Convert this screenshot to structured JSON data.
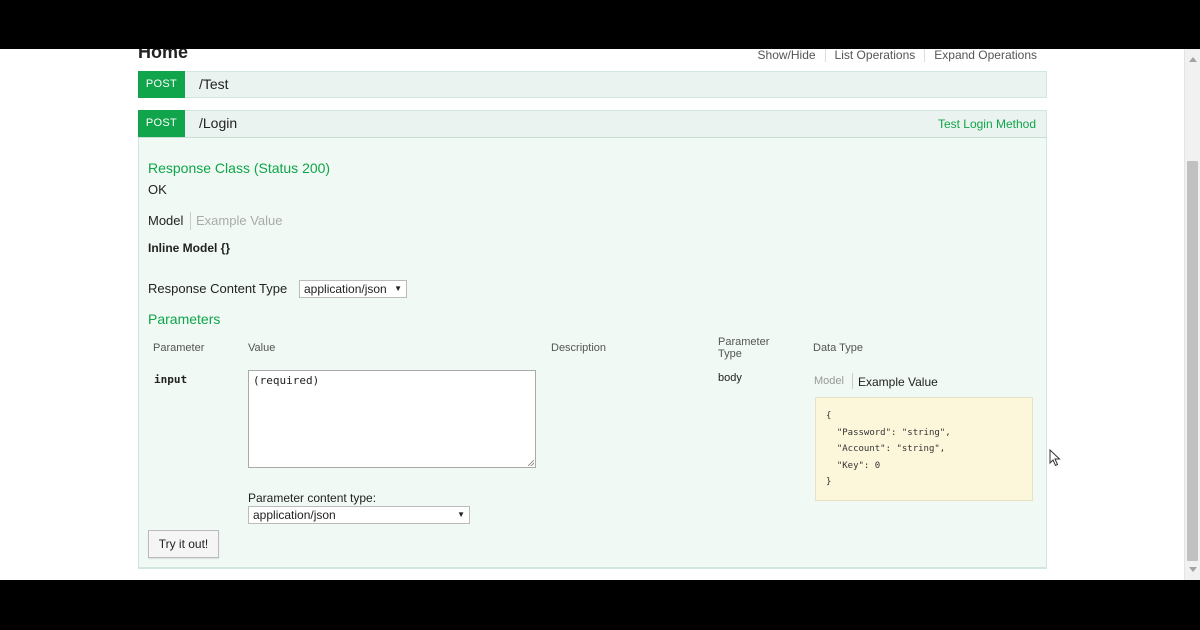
{
  "section_title": "Home",
  "top_links": [
    "Show/Hide",
    "List Operations",
    "Expand Operations"
  ],
  "operations": [
    {
      "method": "POST",
      "path": "/Test"
    },
    {
      "method": "POST",
      "path": "/Login",
      "right_link": "Test Login Method"
    }
  ],
  "response": {
    "class_heading": "Response Class (Status 200)",
    "class_value": "OK",
    "model_tab": "Model",
    "example_tab": "Example Value",
    "inline_model": "Inline Model {}",
    "content_type_label": "Response Content Type",
    "content_type_value": "application/json"
  },
  "parameters": {
    "heading": "Parameters",
    "columns": {
      "parameter": "Parameter",
      "value": "Value",
      "description": "Description",
      "parameter_type_line1": "Parameter",
      "parameter_type_line2": "Type",
      "data_type": "Data Type"
    },
    "row": {
      "name": "input",
      "placeholder": "(required)",
      "param_type": "body",
      "model_tab": "Model",
      "example_tab": "Example Value",
      "content_type_label": "Parameter content type:",
      "content_type_value": "application/json"
    },
    "example_json_lines": [
      "{",
      "  \"Password\": \"string\",",
      "  \"Account\": \"string\",",
      "  \"Key\": 0",
      "}"
    ]
  },
  "try_button": "Try it out!",
  "colors": {
    "accent": "#10a54a",
    "panel_bg": "#f0f9f4",
    "example_bg": "#fcf6db"
  }
}
